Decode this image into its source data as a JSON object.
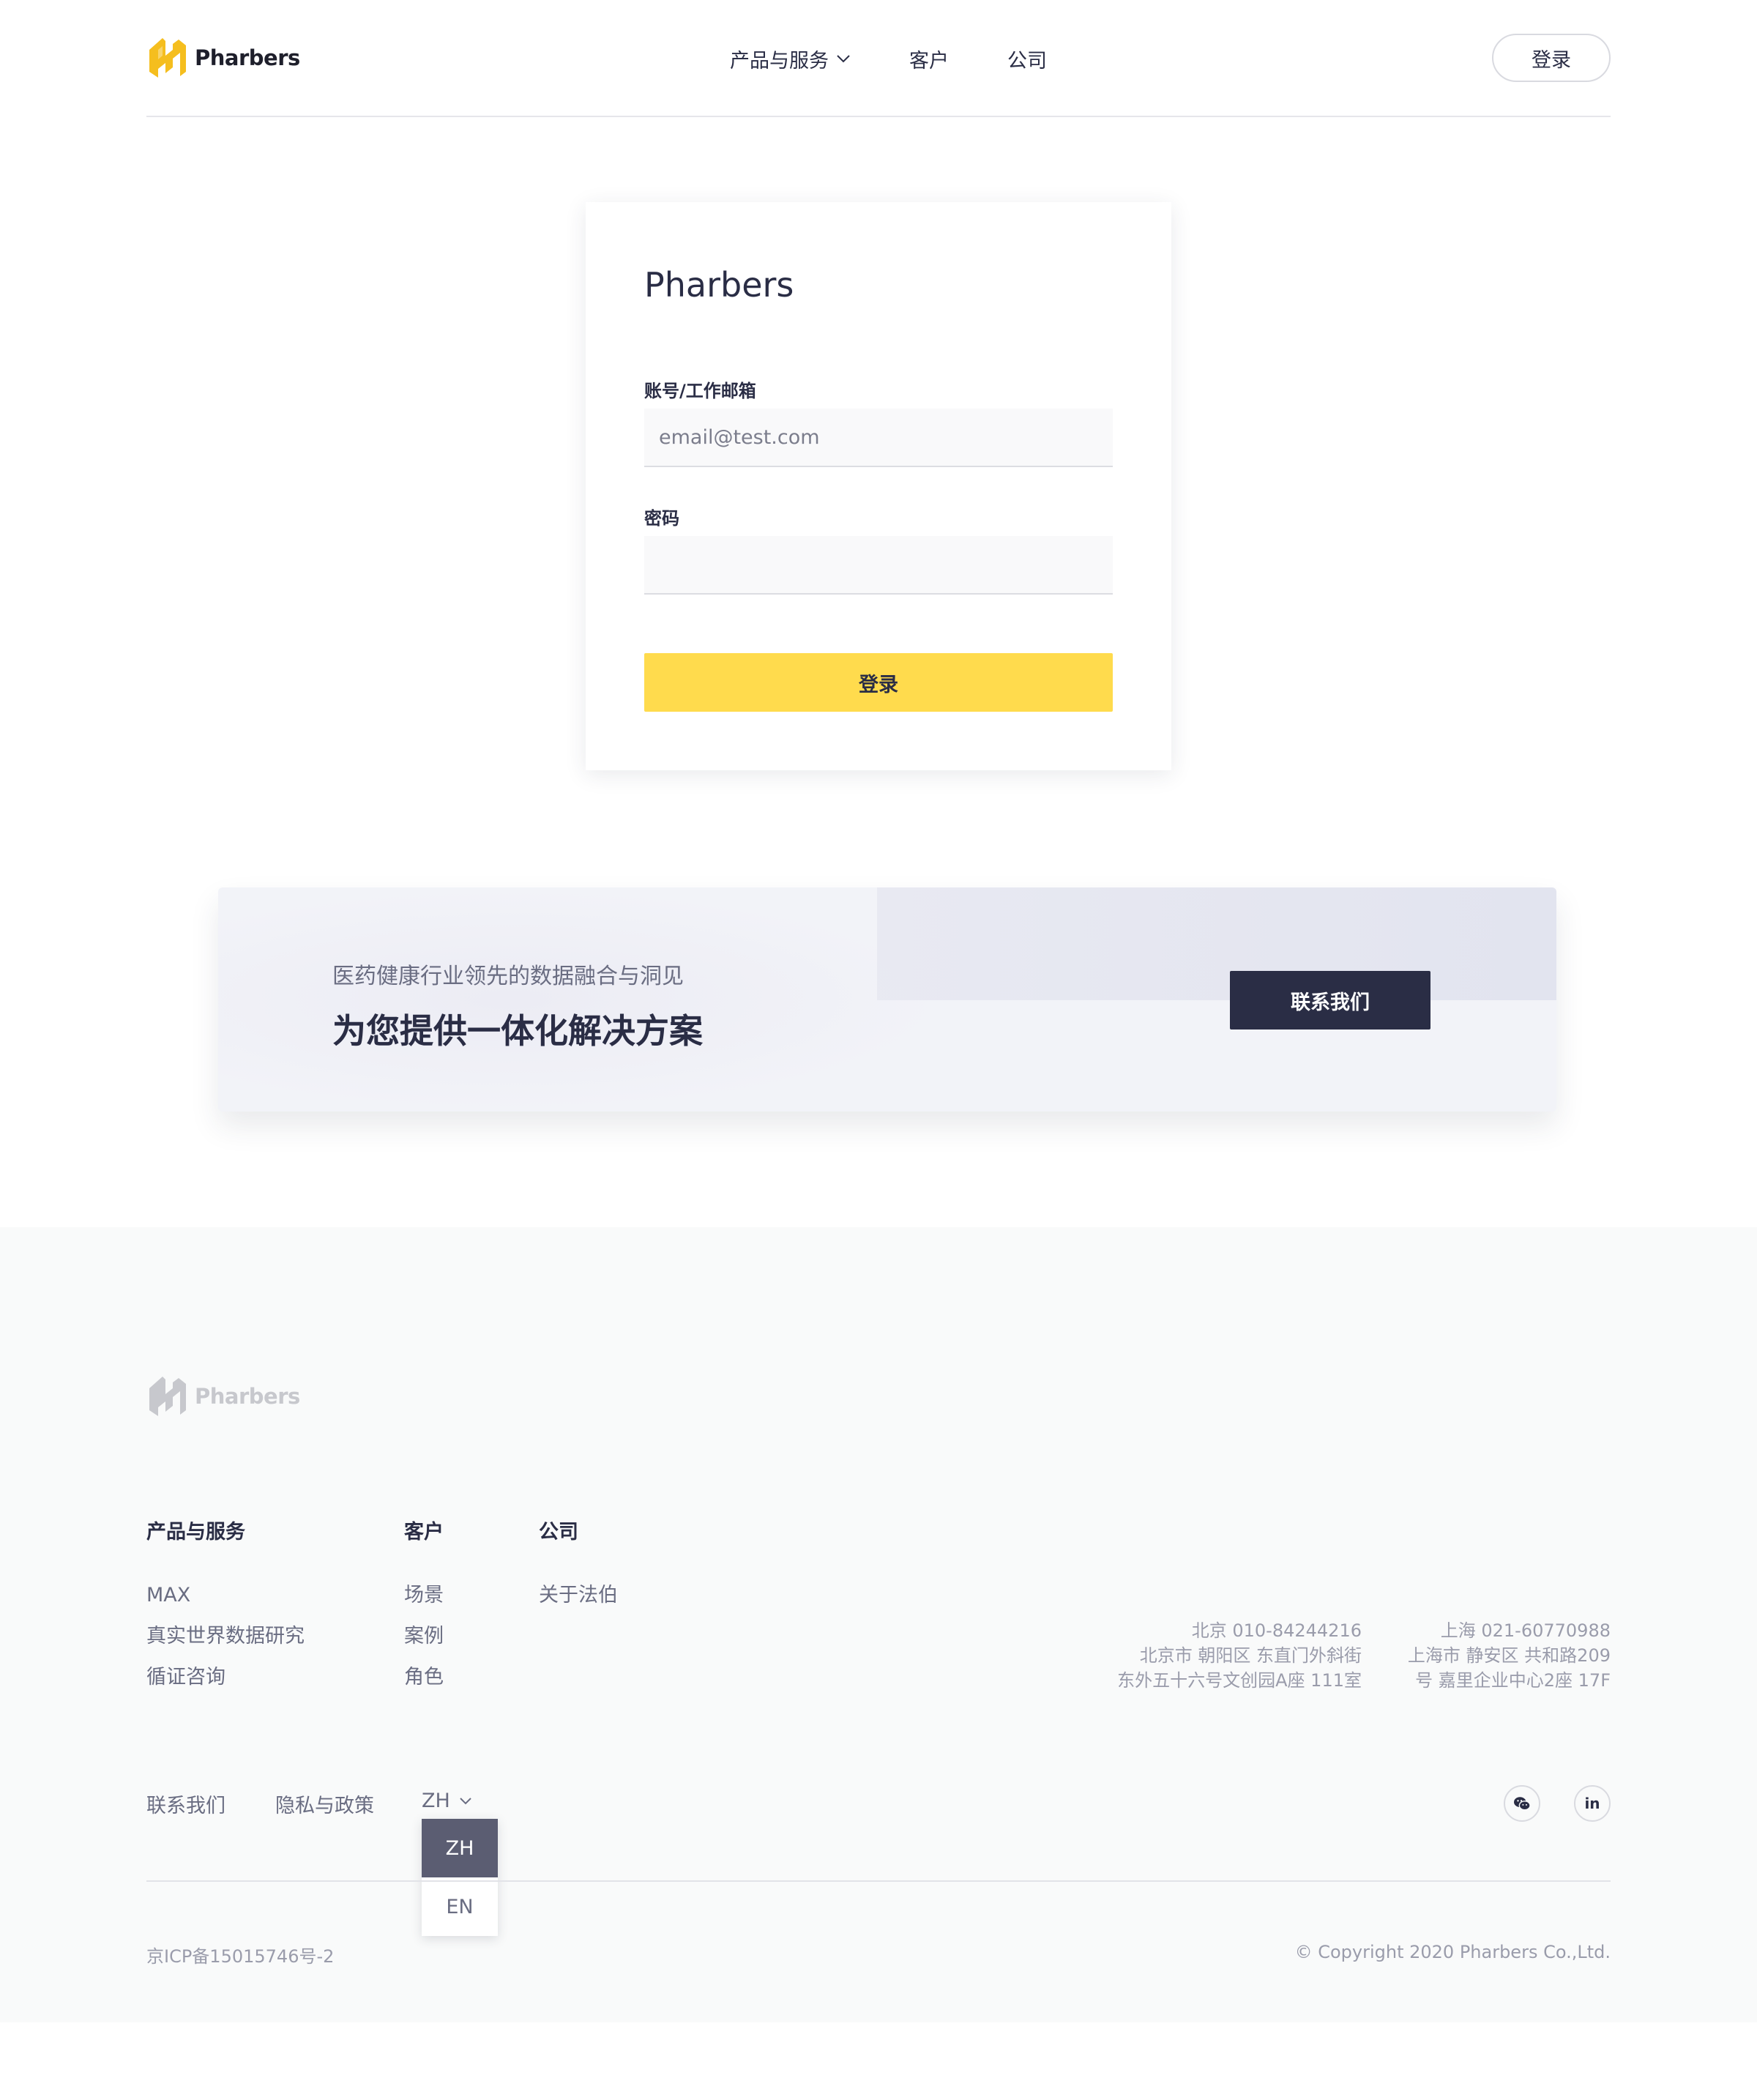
{
  "brand": {
    "name": "Pharbers",
    "logo_color": "#F5BE1E",
    "footer_logo_color": "#C7C8CD"
  },
  "header": {
    "nav": [
      {
        "label": "产品与服务",
        "has_dropdown": true
      },
      {
        "label": "客户"
      },
      {
        "label": "公司"
      }
    ],
    "login_label": "登录"
  },
  "login_card": {
    "title": "Pharbers",
    "email_label": "账号/工作邮箱",
    "email_placeholder": "email@test.com",
    "email_value": "",
    "password_label": "密码",
    "password_value": "",
    "submit_label": "登录",
    "submit_color": "#FFDB4D"
  },
  "banner": {
    "subtitle": "医药健康行业领先的数据融合与洞见",
    "title": "为您提供一体化解决方案",
    "button_label": "联系我们",
    "button_color": "#2A2D45"
  },
  "footer": {
    "columns": [
      {
        "title": "产品与服务",
        "links": [
          "MAX",
          "真实世界数据研究",
          "循证咨询"
        ]
      },
      {
        "title": "客户",
        "links": [
          "场景",
          "案例",
          "角色"
        ]
      },
      {
        "title": "公司",
        "links": [
          "关于法伯"
        ]
      }
    ],
    "offices": [
      {
        "lines": [
          "北京  010-84244216",
          "北京市 朝阳区 东直门外斜街",
          "东外五十六号文创园A座 111室"
        ]
      },
      {
        "lines": [
          "上海  021-60770988",
          "上海市 静安区 共和路209",
          "号 嘉里企业中心2座 17F"
        ]
      }
    ],
    "bottom_links": [
      "联系我们",
      "隐私与政策"
    ],
    "language": {
      "current": "ZH",
      "options": [
        "ZH",
        "EN"
      ],
      "menu_open": true
    },
    "social": [
      {
        "icon": "wechat-icon"
      },
      {
        "icon": "linkedin-icon",
        "label": "in"
      }
    ],
    "icp": "京ICP备15015746号-2",
    "copyright": "© Copyright 2020 Pharbers Co.,Ltd."
  }
}
